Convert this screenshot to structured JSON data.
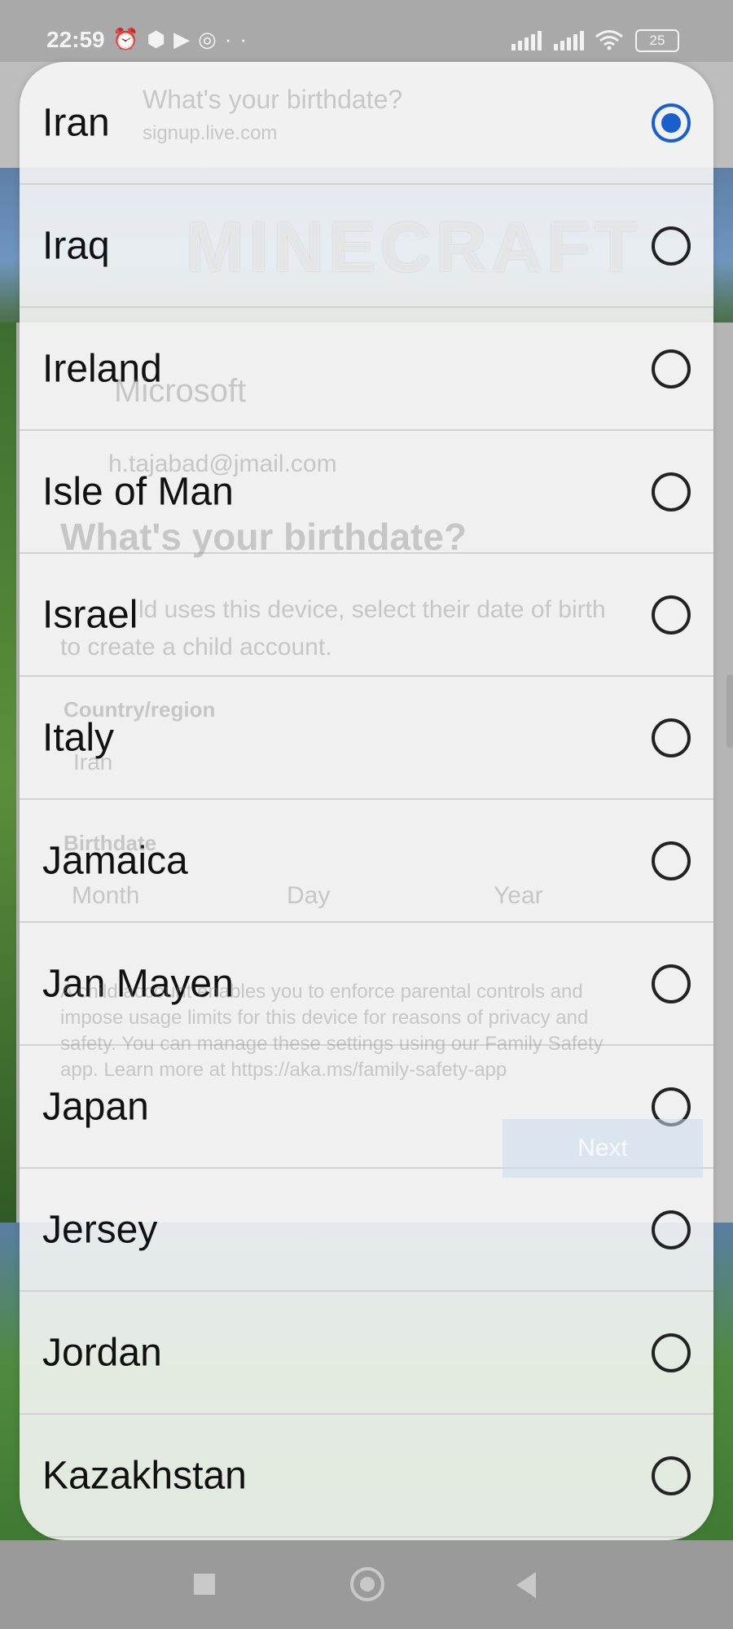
{
  "status_bar": {
    "time": "22:59",
    "icons": [
      "alarm-icon",
      "hexagon-icon",
      "video-icon",
      "instagram-icon",
      "more-dots-icon"
    ],
    "battery": "25"
  },
  "background_page": {
    "browser_title": "What's your birthdate?",
    "browser_url": "signup.live.com",
    "logo_text": "MINECRAFT",
    "brand": "Microsoft",
    "email": "h.tajabad@jmail.com",
    "heading": "What's your birthdate?",
    "description_line1": "ld uses this device, select their date of birth",
    "description_line2": "to create a child account.",
    "country_label": "Country/region",
    "country_value": "Iran",
    "birthdate_label": "Birthdate",
    "month_placeholder": "Month",
    "day_placeholder": "Day",
    "year_placeholder": "Year",
    "notice_line1": "A child account enables you to enforce parental controls and",
    "notice_line2": "impose usage limits for this device for reasons of privacy and",
    "notice_line3": "safety. You can manage these settings using our Family Safety",
    "notice_line4": "app. Learn more at https://aka.ms/family-safety-app",
    "next_button": "Next"
  },
  "country_picker": {
    "selected": "Iran",
    "options": [
      {
        "label": "Iran",
        "selected": true
      },
      {
        "label": "Iraq",
        "selected": false
      },
      {
        "label": "Ireland",
        "selected": false
      },
      {
        "label": "Isle of Man",
        "selected": false
      },
      {
        "label": "Israel",
        "selected": false
      },
      {
        "label": "Italy",
        "selected": false
      },
      {
        "label": "Jamaica",
        "selected": false
      },
      {
        "label": "Jan Mayen",
        "selected": false
      },
      {
        "label": "Japan",
        "selected": false
      },
      {
        "label": "Jersey",
        "selected": false
      },
      {
        "label": "Jordan",
        "selected": false
      },
      {
        "label": "Kazakhstan",
        "selected": false
      }
    ]
  },
  "colors": {
    "accent": "#1a5fd0",
    "sheet_background": "#f8f8f8"
  }
}
